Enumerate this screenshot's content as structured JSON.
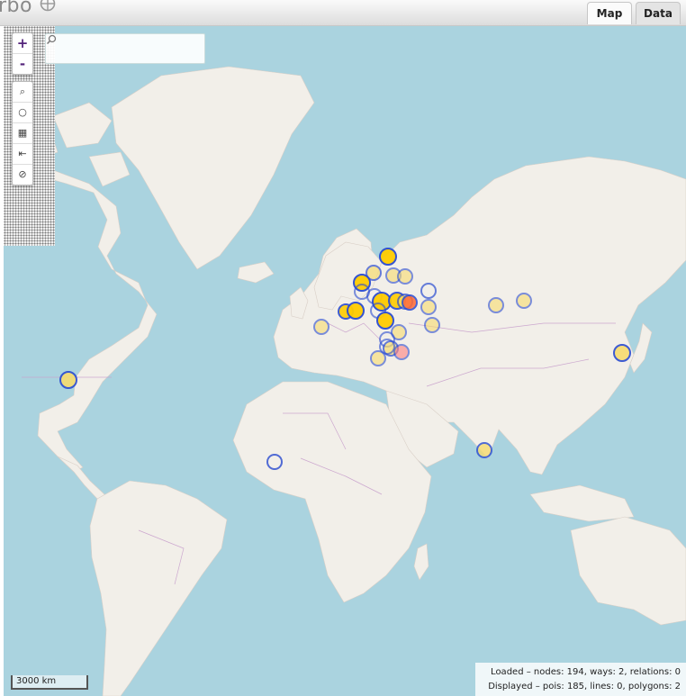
{
  "app": {
    "title": "rbo"
  },
  "tabs": [
    {
      "label": "Map",
      "active": true
    },
    {
      "label": "Data",
      "active": false
    }
  ],
  "search": {
    "value": "",
    "placeholder": ""
  },
  "zoom": {
    "in_label": "+",
    "out_label": "-"
  },
  "tools": [
    "search-icon",
    "circle-icon",
    "image-icon",
    "export-icon",
    "clear-icon"
  ],
  "scale": {
    "label": "3000 km"
  },
  "stats": {
    "loaded_label": "Loaded",
    "loaded_text": " – nodes: 194, ways: 2, relations: 0",
    "displayed_label": "Displayed",
    "displayed_text": " – pois: 185, lines: 0, polygons: 2"
  },
  "colors": {
    "water": "#aad3df",
    "land": "#f2efe9",
    "border": "#c8a0cc",
    "poi_fill": "#ffcc00",
    "poi_stroke": "#0033ff",
    "poi_red": "#ff5533"
  }
}
